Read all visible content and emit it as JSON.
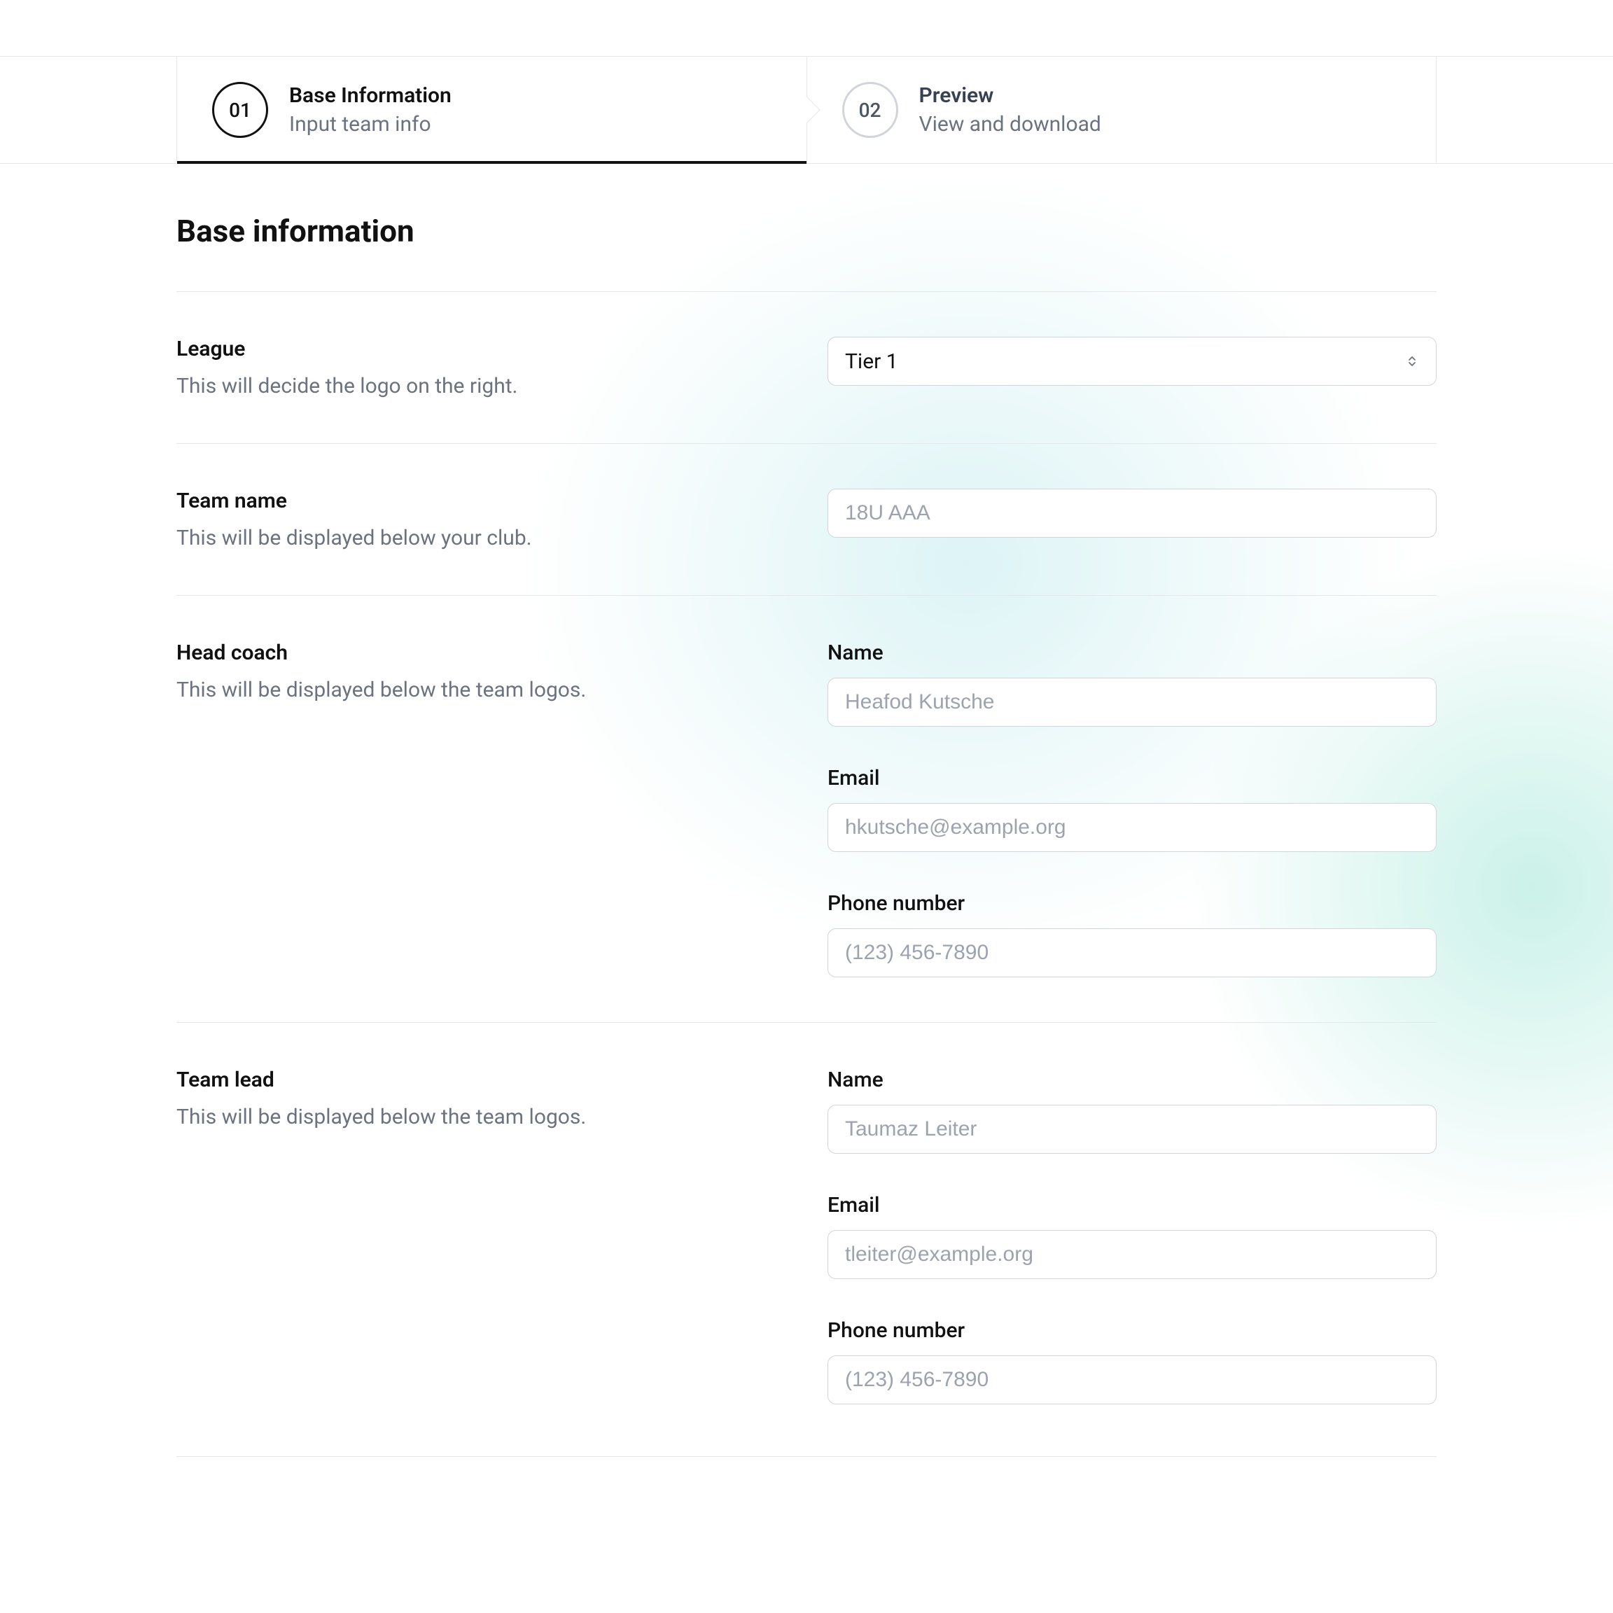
{
  "steps": [
    {
      "num": "01",
      "title": "Base Information",
      "sub": "Input team info"
    },
    {
      "num": "02",
      "title": "Preview",
      "sub": "View and download"
    }
  ],
  "heading": "Base information",
  "league": {
    "label": "League",
    "desc": "This will decide the logo on the right.",
    "selected": "Tier 1"
  },
  "team_name": {
    "label": "Team name",
    "desc": "This will be displayed below your club.",
    "placeholder": "18U AAA"
  },
  "head_coach": {
    "label": "Head coach",
    "desc": "This will be displayed below the team logos.",
    "name_label": "Name",
    "name_placeholder": "Heafod Kutsche",
    "email_label": "Email",
    "email_placeholder": "hkutsche@example.org",
    "phone_label": "Phone number",
    "phone_placeholder": "(123) 456-7890"
  },
  "team_lead": {
    "label": "Team lead",
    "desc": "This will be displayed below the team logos.",
    "name_label": "Name",
    "name_placeholder": "Taumaz Leiter",
    "email_label": "Email",
    "email_placeholder": "tleiter@example.org",
    "phone_label": "Phone number",
    "phone_placeholder": "(123) 456-7890"
  }
}
